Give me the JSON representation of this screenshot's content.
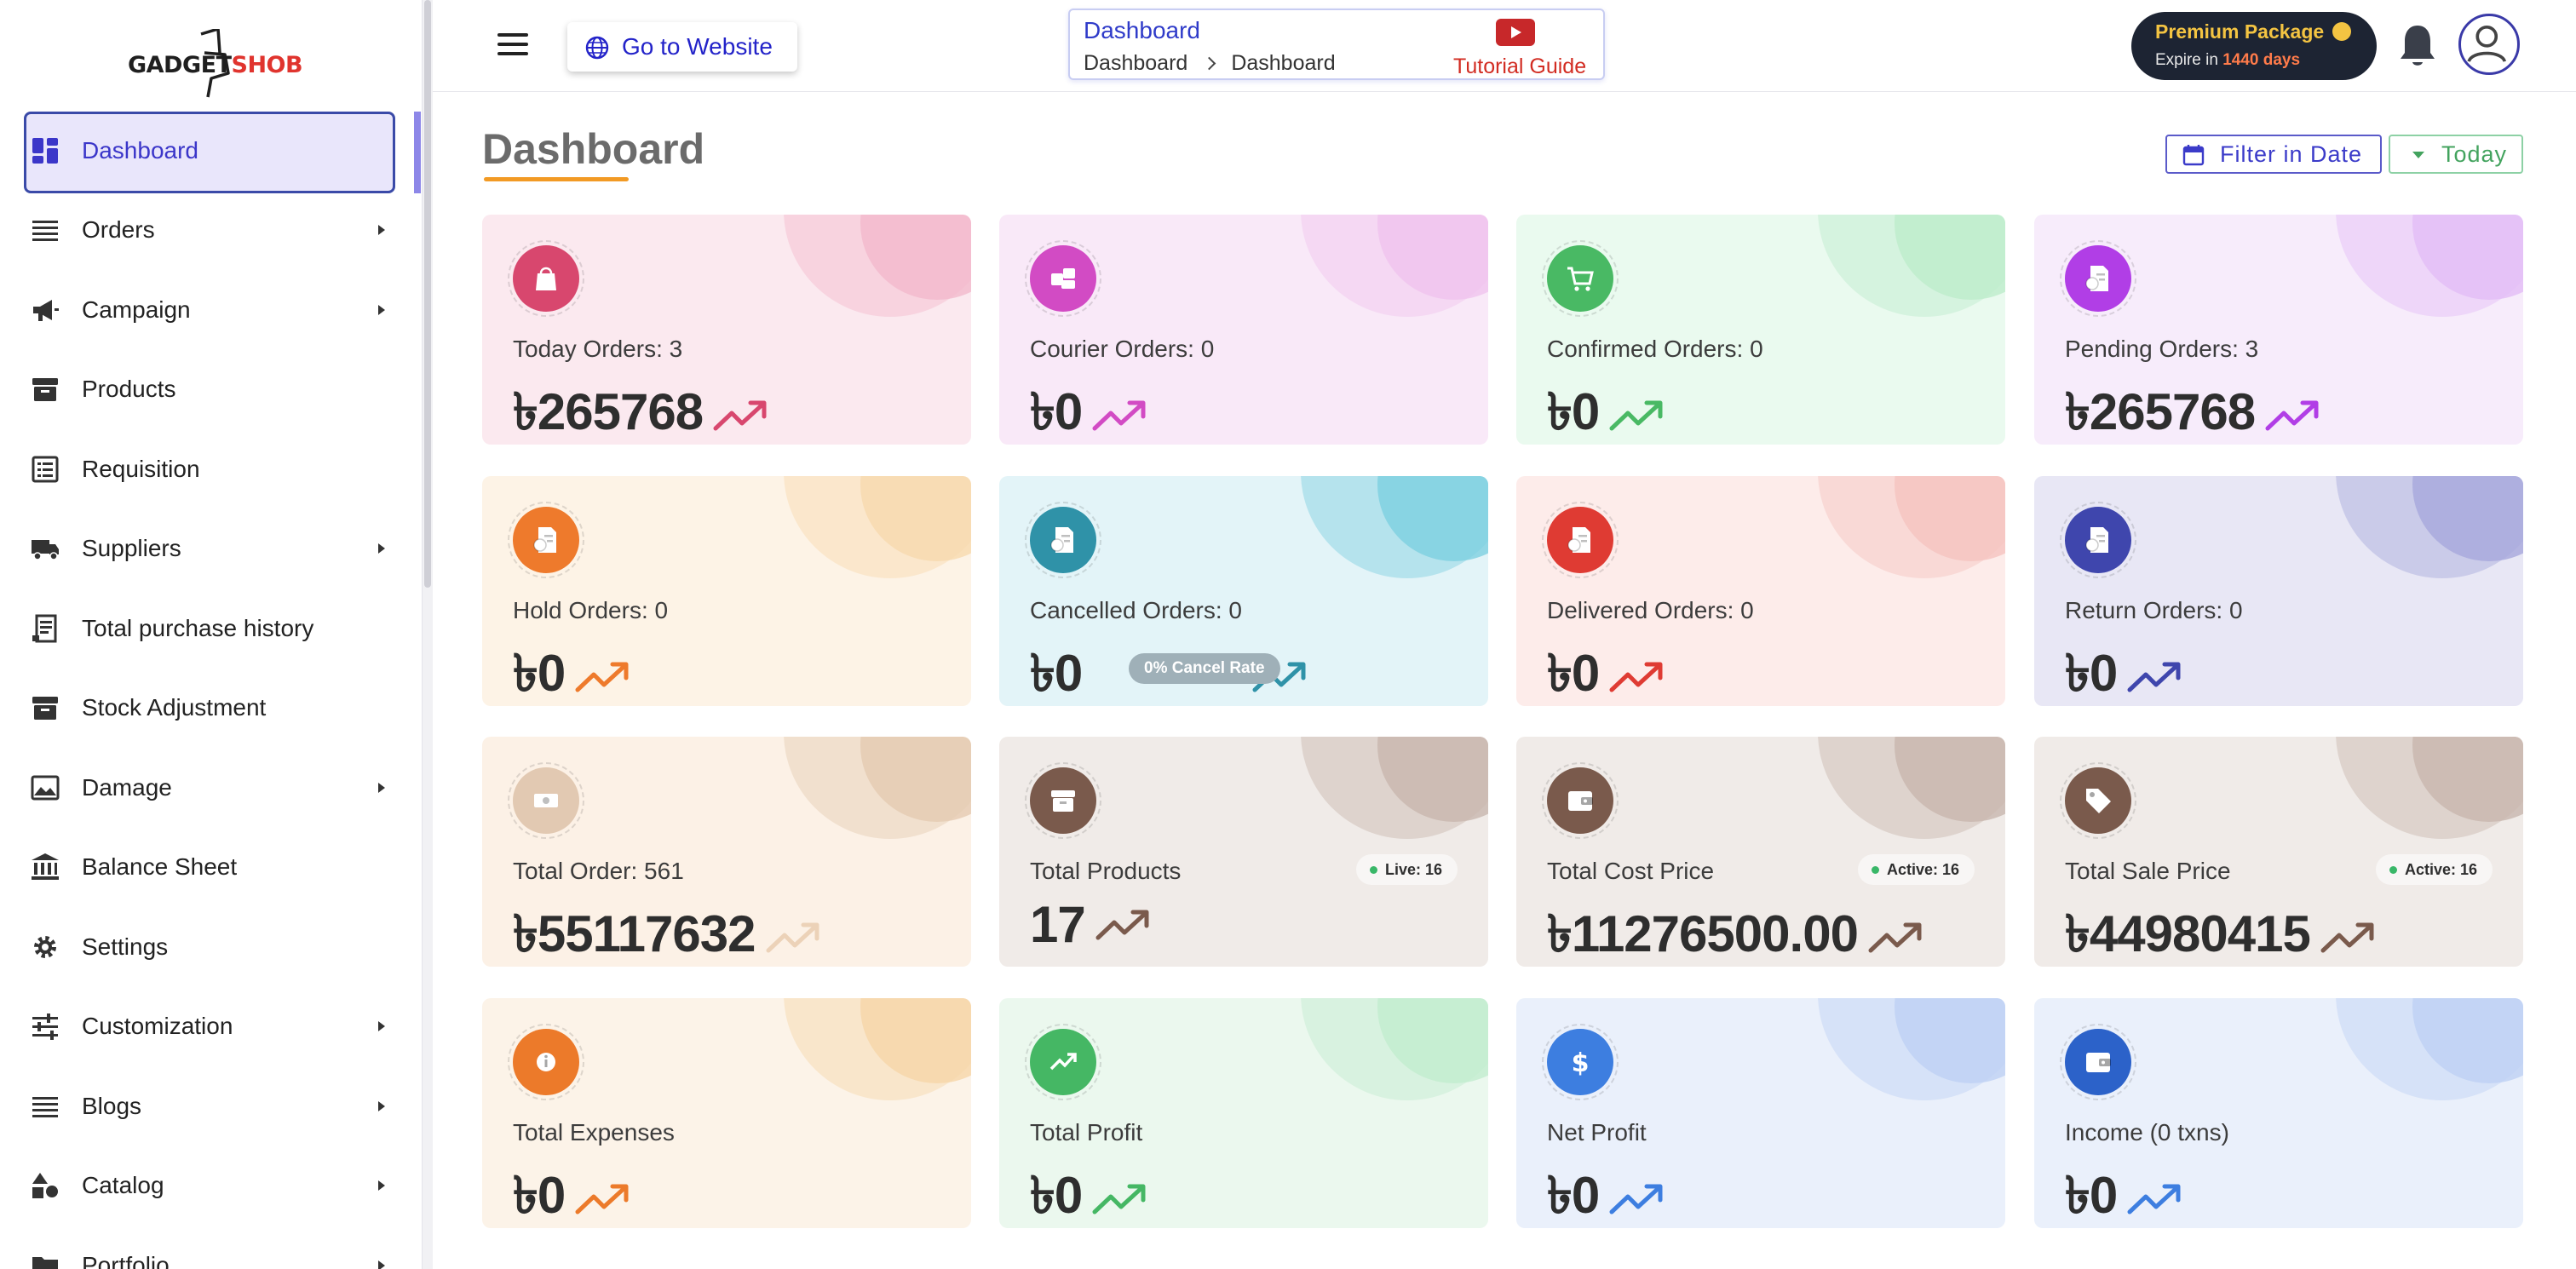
{
  "brand": {
    "logo_text_a": "GADGET",
    "logo_text_b": "SHOB"
  },
  "sidebar": {
    "items": [
      {
        "label": "Dashboard",
        "icon": "dashboard-icon",
        "active": true,
        "has_submenu": false
      },
      {
        "label": "Orders",
        "icon": "list-icon",
        "has_submenu": true
      },
      {
        "label": "Campaign",
        "icon": "megaphone-icon",
        "has_submenu": true
      },
      {
        "label": "Products",
        "icon": "archive-icon",
        "has_submenu": false
      },
      {
        "label": "Requisition",
        "icon": "checklist-icon",
        "has_submenu": false
      },
      {
        "label": "Suppliers",
        "icon": "truck-icon",
        "has_submenu": true
      },
      {
        "label": "Total purchase history",
        "icon": "receipt-icon",
        "has_submenu": false
      },
      {
        "label": "Stock Adjustment",
        "icon": "archive-icon",
        "has_submenu": false
      },
      {
        "label": "Damage",
        "icon": "image-icon",
        "has_submenu": true
      },
      {
        "label": "Balance Sheet",
        "icon": "bank-icon",
        "has_submenu": false
      },
      {
        "label": "Settings",
        "icon": "gear-icon",
        "has_submenu": false
      },
      {
        "label": "Customization",
        "icon": "sliders-icon",
        "has_submenu": true
      },
      {
        "label": "Blogs",
        "icon": "list-icon",
        "has_submenu": true
      },
      {
        "label": "Catalog",
        "icon": "shapes-icon",
        "has_submenu": true
      },
      {
        "label": "Portfolio",
        "icon": "folder-icon",
        "has_submenu": true
      }
    ]
  },
  "topbar": {
    "go_to_website": "Go to Website",
    "breadcrumb": {
      "title": "Dashboard",
      "path": [
        "Dashboard",
        "Dashboard"
      ],
      "tutorial": "Tutorial Guide"
    },
    "premium": {
      "title": "Premium Package",
      "expire_prefix": "Expire in",
      "expire_value": "1440 days"
    }
  },
  "main": {
    "title": "Dashboard",
    "filter_label": "Filter in Date",
    "today_label": "Today"
  },
  "cards": [
    {
      "label": "Today Orders: 3",
      "value": "৳265768",
      "icon": "shopping-bag-icon"
    },
    {
      "label": "Courier Orders: 0",
      "value": "৳0",
      "icon": "courier-icon"
    },
    {
      "label": "Confirmed Orders: 0",
      "value": "৳0",
      "icon": "cart-icon"
    },
    {
      "label": "Pending Orders: 3",
      "value": "৳265768",
      "icon": "invoice-icon"
    },
    {
      "label": "Hold Orders: 0",
      "value": "৳0",
      "icon": "invoice-icon"
    },
    {
      "label": "Cancelled Orders: 0",
      "value": "৳0",
      "icon": "invoice-icon",
      "chip": "0% Cancel Rate"
    },
    {
      "label": "Delivered Orders: 0",
      "value": "৳0",
      "icon": "invoice-icon"
    },
    {
      "label": "Return Orders: 0",
      "value": "৳0",
      "icon": "invoice-icon"
    },
    {
      "label": "Total Order: 561",
      "value": "৳55117632",
      "icon": "money-icon"
    },
    {
      "label": "Total Products",
      "value": "17",
      "icon": "archive-icon",
      "badge": "Live: 16"
    },
    {
      "label": "Total Cost Price",
      "value": "৳11276500.00",
      "icon": "wallet-icon",
      "badge": "Active: 16"
    },
    {
      "label": "Total Sale Price",
      "value": "৳44980415",
      "icon": "tag-icon",
      "badge": "Active: 16"
    },
    {
      "label": "Total Expenses",
      "value": "৳0",
      "icon": "info-icon"
    },
    {
      "label": "Total Profit",
      "value": "৳0",
      "icon": "trend-icon"
    },
    {
      "label": "Net Profit",
      "value": "৳0",
      "icon": "dollar-icon"
    },
    {
      "label": "Income (0 txns)",
      "value": "৳0",
      "icon": "wallet-icon"
    }
  ],
  "colors": {
    "accent": "#3b36c9",
    "card_themes": [
      {
        "bg": "#fbe9ef",
        "circle": "#f3b9cc",
        "icon": "#d8476e",
        "trend": "#d8476e"
      },
      {
        "bg": "#f9e9f8",
        "circle": "#f0c3ee",
        "icon": "#d24bc4",
        "trend": "#d24bc4"
      },
      {
        "bg": "#eafaef",
        "circle": "#bdeccb",
        "icon": "#49b964",
        "trend": "#49b964"
      },
      {
        "bg": "#f7ecfb",
        "circle": "#e2bdf6",
        "icon": "#b13ee6",
        "trend": "#b13ee6"
      },
      {
        "bg": "#fdf3e6",
        "circle": "#f8d9ae",
        "icon": "#ee7a2c",
        "trend": "#ee7a2c"
      },
      {
        "bg": "#e3f4f8",
        "circle": "#7dcfe0",
        "icon": "#2f92a8",
        "trend": "#2f92a8"
      },
      {
        "bg": "#fdecea",
        "circle": "#f5c3bf",
        "icon": "#df3b33",
        "trend": "#df3b33"
      },
      {
        "bg": "#e8e7f5",
        "circle": "#a6a8dc",
        "icon": "#3f46ad",
        "trend": "#3f46ad"
      },
      {
        "bg": "#fcf1e6",
        "circle": "#e5cbb1",
        "icon": "#e2c9b2",
        "trend": "#ecd2b8"
      },
      {
        "bg": "#f0ebe8",
        "circle": "#c8b6ae",
        "icon": "#7a5a4c",
        "trend": "#7a5a4c"
      },
      {
        "bg": "#f0ebe8",
        "circle": "#c8b6ae",
        "icon": "#7a5a4c",
        "trend": "#7a5a4c"
      },
      {
        "bg": "#f0ebe8",
        "circle": "#c8b6ae",
        "icon": "#7a5a4c",
        "trend": "#7a5a4c"
      },
      {
        "bg": "#fcf3e8",
        "circle": "#f6d6a8",
        "icon": "#ec7a2a",
        "trend": "#ec7a2a"
      },
      {
        "bg": "#ebf8ee",
        "circle": "#c2ecce",
        "icon": "#45b764",
        "trend": "#45b764"
      },
      {
        "bg": "#eaf0fb",
        "circle": "#bed1f4",
        "icon": "#3d7ee0",
        "trend": "#3d7ee0"
      },
      {
        "bg": "#eaf0fb",
        "circle": "#bed1f4",
        "icon": "#2c62c9",
        "trend": "#3d7ee0"
      }
    ]
  }
}
